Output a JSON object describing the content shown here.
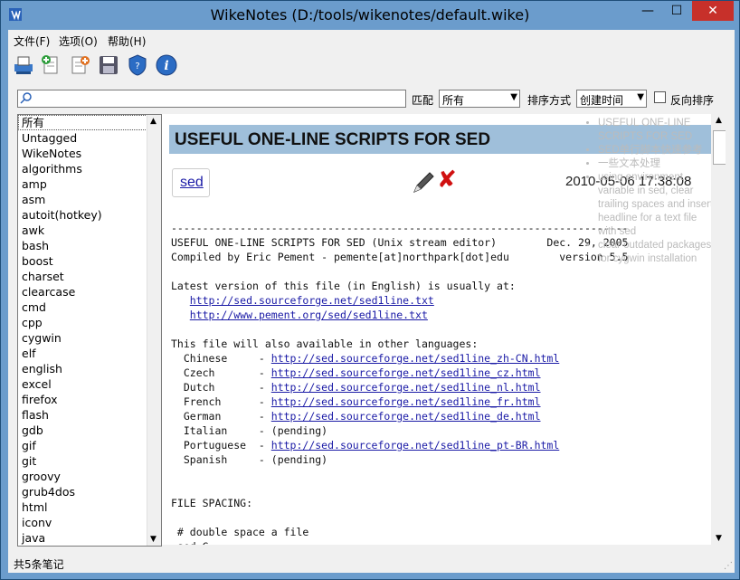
{
  "window": {
    "title": "WikeNotes (D:/tools/wikenotes/default.wike)",
    "minimize": "—",
    "maximize": "☐",
    "close": "✕"
  },
  "menu": [
    "文件(F)",
    "选项(O)",
    "帮助(H)"
  ],
  "toolbar": {
    "buttons": [
      "print-icon",
      "new-note-icon",
      "edit-note-icon",
      "save-icon",
      "shield-icon",
      "info-icon"
    ]
  },
  "search": {
    "placeholder": "",
    "match_label": "匹配",
    "match_value": "所有",
    "sort_label": "排序方式",
    "sort_value": "创建时间",
    "reverse_label": "反向排序"
  },
  "tags": [
    "所有",
    "Untagged",
    "WikeNotes",
    "algorithms",
    "amp",
    "asm",
    "autoit(hotkey)",
    "awk",
    "bash",
    "boost",
    "charset",
    "clearcase",
    "cmd",
    "cpp",
    "cygwin",
    "elf",
    "english",
    "excel",
    "firefox",
    "flash",
    "gdb",
    "gif",
    "git",
    "groovy",
    "grub4dos",
    "html",
    "iconv",
    "java"
  ],
  "note": {
    "title": "USEFUL ONE-LINE SCRIPTS FOR SED",
    "tag": "sed",
    "date": "2010-05-06 17:38:08",
    "body_lines": [
      {
        "t": "-------------------------------------------------------------------------"
      },
      {
        "t": "USEFUL ONE-LINE SCRIPTS FOR SED (Unix stream editor)        Dec. 29, 2005"
      },
      {
        "t": "Compiled by Eric Pement - pemente[at]northpark[dot]edu        version 5.5"
      },
      {
        "t": ""
      },
      {
        "t": "Latest version of this file (in English) is usually at:"
      },
      {
        "t": "   ",
        "link": "http://sed.sourceforge.net/sed1line.txt"
      },
      {
        "t": "   ",
        "link": "http://www.pement.org/sed/sed1line.txt"
      },
      {
        "t": ""
      },
      {
        "t": "This file will also available in other languages:"
      },
      {
        "t": "  Chinese     - ",
        "link": "http://sed.sourceforge.net/sed1line_zh-CN.html"
      },
      {
        "t": "  Czech       - ",
        "link": "http://sed.sourceforge.net/sed1line_cz.html"
      },
      {
        "t": "  Dutch       - ",
        "link": "http://sed.sourceforge.net/sed1line_nl.html"
      },
      {
        "t": "  French      - ",
        "link": "http://sed.sourceforge.net/sed1line_fr.html"
      },
      {
        "t": "  German      - ",
        "link": "http://sed.sourceforge.net/sed1line_de.html"
      },
      {
        "t": "  Italian     - (pending)"
      },
      {
        "t": "  Portuguese  - ",
        "link": "http://sed.sourceforge.net/sed1line_pt-BR.html"
      },
      {
        "t": "  Spanish     - (pending)"
      },
      {
        "t": ""
      },
      {
        "t": ""
      },
      {
        "t": "FILE SPACING:"
      },
      {
        "t": ""
      },
      {
        "t": " # double space a file"
      },
      {
        "t": " sed G"
      }
    ]
  },
  "recent_notes": [
    "USEFUL ONE-LINE SCRIPTS FOR SED",
    "SED单行脚本快速参考",
    "一些文本处理",
    "using environment variable in sed, clear trailing spaces and insert headline for a text file with sed",
    "clear outdated packages for cygwin installation"
  ],
  "status": "共5条笔记"
}
